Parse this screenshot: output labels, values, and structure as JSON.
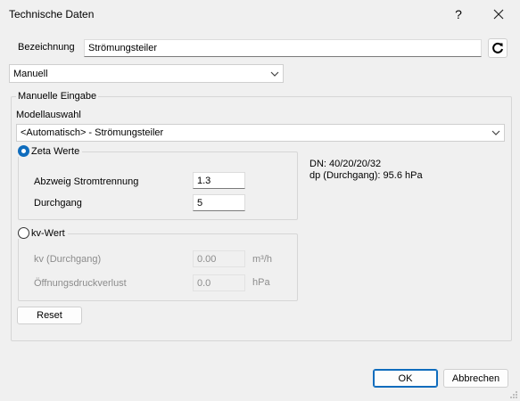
{
  "window": {
    "title": "Technische Daten",
    "help_glyph": "?"
  },
  "header": {
    "bezeichnung_label": "Bezeichnung",
    "bezeichnung_value": "Strömungsteiler"
  },
  "mode_select": {
    "value": "Manuell"
  },
  "manual": {
    "legend": "Manuelle Eingabe",
    "model_label": "Modellauswahl",
    "model_value": "<Automatisch> - Strömungsteiler",
    "zeta": {
      "label": "Zeta Werte",
      "selected": true,
      "fields": [
        {
          "label": "Abzweig Stromtrennung",
          "value": "1.3"
        },
        {
          "label": "Durchgang",
          "value": "5"
        }
      ]
    },
    "kv": {
      "label": "kv-Wert",
      "selected": false,
      "fields": [
        {
          "label": "kv (Durchgang)",
          "value": "0.00",
          "unit": "m³/h"
        },
        {
          "label": "Öffnungsdruckverlust",
          "value": "0.0",
          "unit": "hPa"
        }
      ]
    },
    "info": {
      "dn": "DN: 40/20/20/32",
      "dp": "dp (Durchgang): 95.6 hPa"
    },
    "reset_label": "Reset"
  },
  "footer": {
    "ok_label": "OK",
    "cancel_label": "Abbrechen"
  },
  "colors": {
    "accent": "#0f6cbd",
    "background": "#f0f0f0"
  }
}
